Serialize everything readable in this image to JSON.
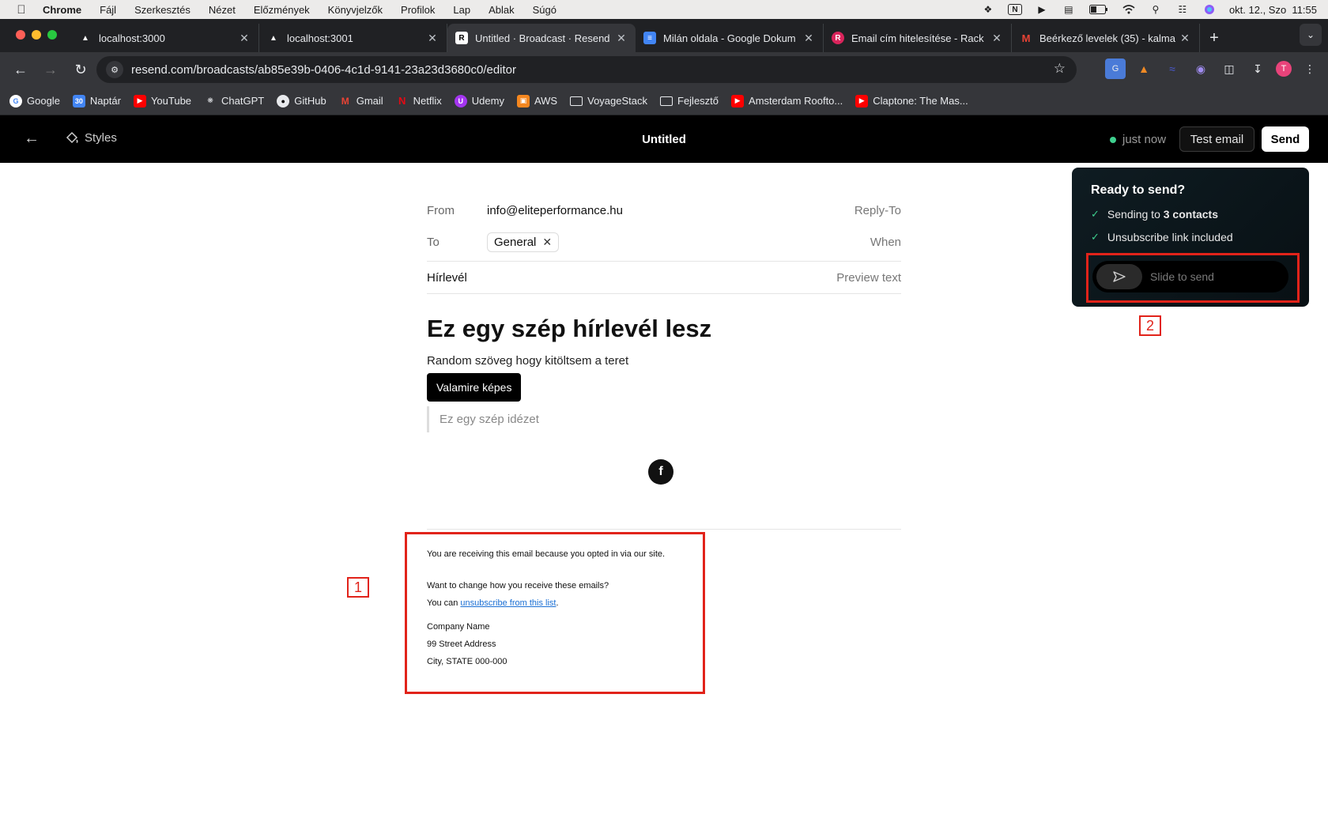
{
  "menubar": {
    "app": "Chrome",
    "items": [
      "Fájl",
      "Szerkesztés",
      "Nézet",
      "Előzmények",
      "Könyvjelzők",
      "Profilok",
      "Lap",
      "Ablak",
      "Súgó"
    ],
    "datetime": "okt. 12., Szo  11:55"
  },
  "tabs": [
    {
      "title": "localhost:3000",
      "icon": "vercel-triangle-icon"
    },
    {
      "title": "localhost:3001",
      "icon": "vercel-triangle-icon"
    },
    {
      "title": "Untitled · Broadcast · Resend",
      "icon": "resend-icon"
    },
    {
      "title": "Milán oldala - Google Dokum",
      "icon": "google-docs-icon"
    },
    {
      "title": "Email cím hitelesítése - Rack",
      "icon": "rack-icon"
    },
    {
      "title": "Beérkező levelek (35) - kalma",
      "icon": "gmail-icon"
    }
  ],
  "address": {
    "url": "resend.com/broadcasts/ab85e39b-0406-4c1d-9141-23a23d3680c0/editor"
  },
  "bookmarks": [
    "Google",
    "Naptár",
    "YouTube",
    "ChatGPT",
    "GitHub",
    "Gmail",
    "Netflix",
    "Udemy",
    "AWS",
    "VoyageStack",
    "Fejlesztő",
    "Amsterdam Roofto...",
    "Claptone: The Mas..."
  ],
  "header": {
    "styles_label": "Styles",
    "title": "Untitled",
    "saved_status": "just now",
    "test_email_label": "Test email",
    "send_label": "Send"
  },
  "editor": {
    "from_label": "From",
    "from_value": "info@eliteperformance.hu",
    "reply_to_label": "Reply-To",
    "to_label": "To",
    "to_chip": "General",
    "when_label": "When",
    "subject": "Hírlevél",
    "preview_text_label": "Preview text",
    "heading": "Ez egy szép hírlevél lesz",
    "paragraph": "Random szöveg hogy kitöltsem a teret",
    "button_label": "Valamire képes",
    "quote": "Ez egy szép idézet"
  },
  "footer": {
    "line1": "You are receiving this email because you opted in via our site.",
    "line2": "Want to change how you receive these emails?",
    "line3_prefix": "You can ",
    "unsubscribe_link": "unsubscribe from this list",
    "line3_suffix": ".",
    "company": "Company Name",
    "street": "99 Street Address",
    "city": "City, STATE 000-000"
  },
  "popover": {
    "title": "Ready to send?",
    "sending_prefix": "Sending to ",
    "contacts": "3 contacts",
    "unsubscribe_check": "Unsubscribe link included",
    "slider_label": "Slide to send"
  },
  "annotations": {
    "one": "1",
    "two": "2"
  },
  "colors": {
    "annotation": "#e1231a",
    "status_dot": "#3ecf8e",
    "link": "#1a6fd4"
  }
}
